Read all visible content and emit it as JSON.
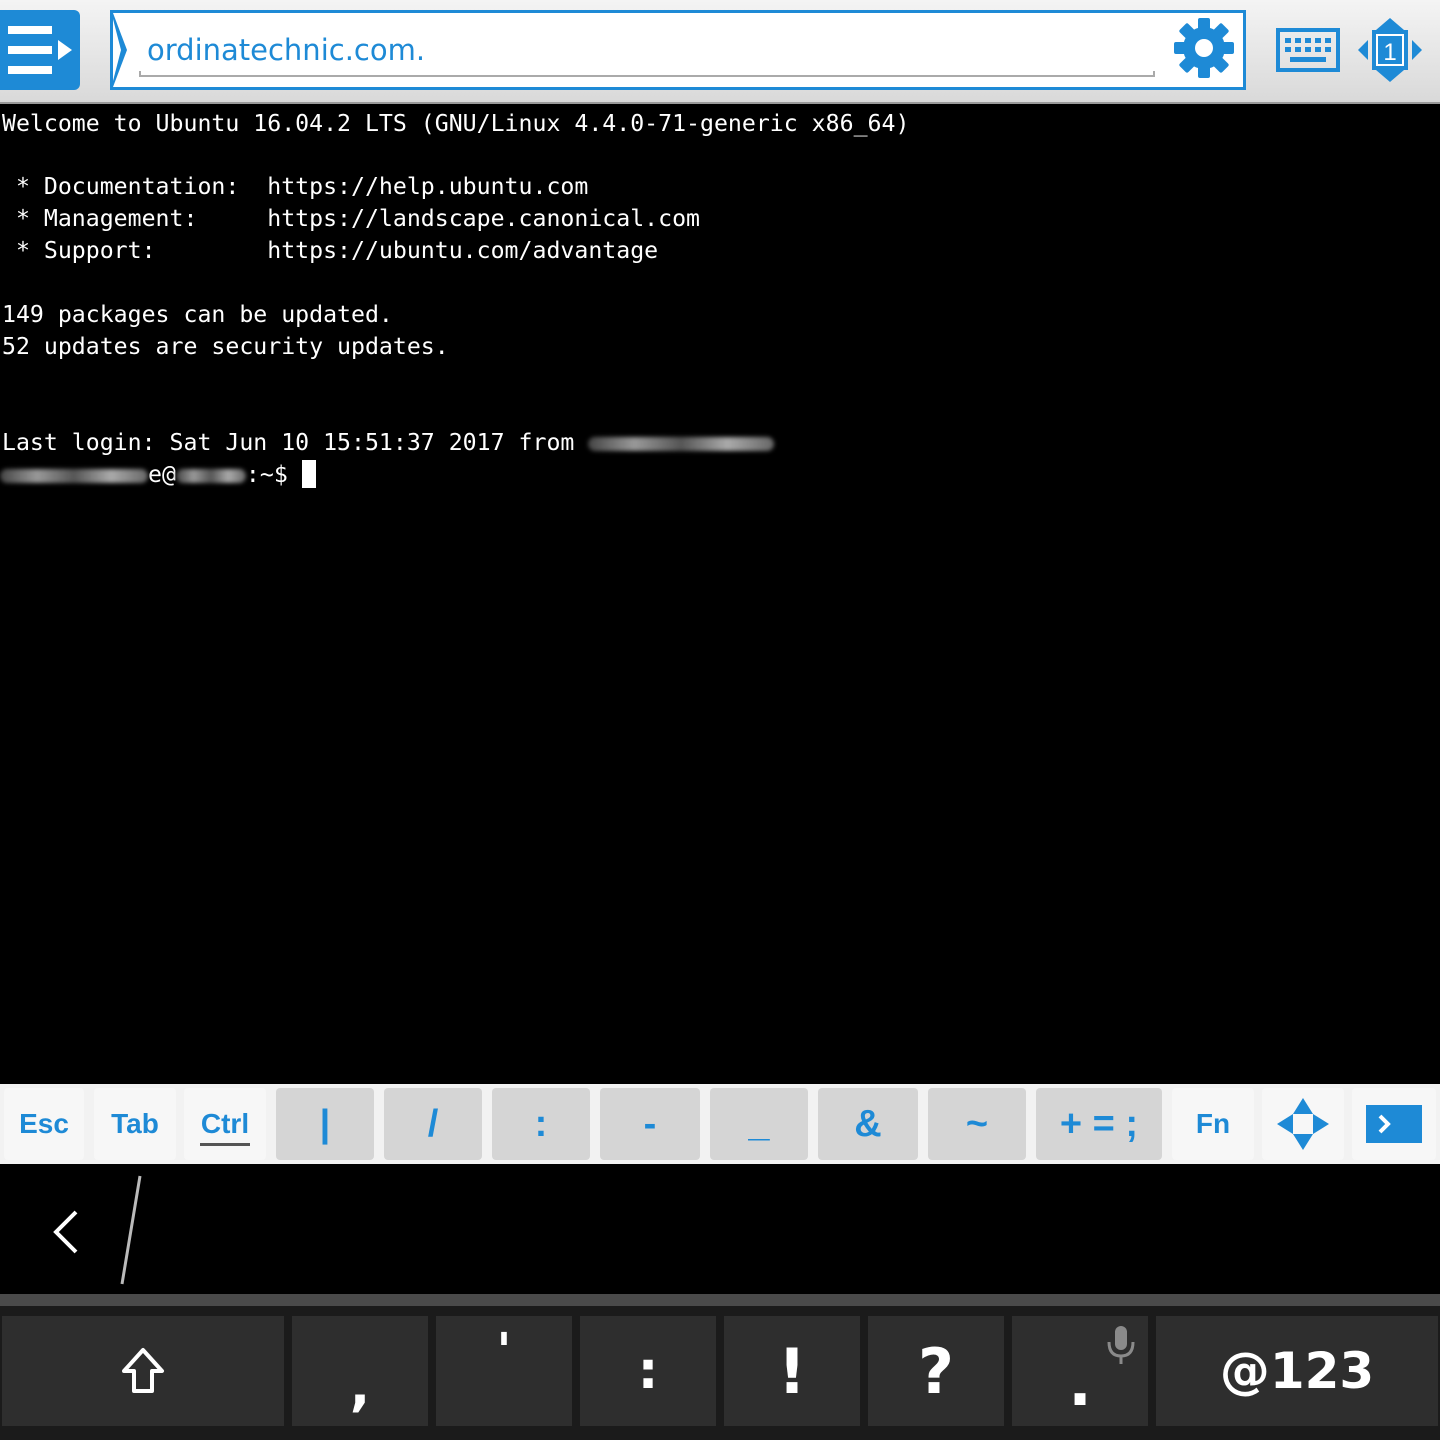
{
  "toolbar": {
    "address": "ordinatechnic.com.",
    "session_number": "1",
    "accent_color": "#1e8ad6",
    "icons": [
      "menu-icon",
      "gear-icon",
      "keyboard-icon",
      "screens-icon"
    ]
  },
  "terminal": {
    "lines": [
      "Welcome to Ubuntu 16.04.2 LTS (GNU/Linux 4.4.0-71-generic x86_64)",
      "",
      " * Documentation:  https://help.ubuntu.com",
      " * Management:     https://landscape.canonical.com",
      " * Support:        https://ubuntu.com/advantage",
      "",
      "149 packages can be updated.",
      "52 updates are security updates.",
      "",
      "",
      "Last login: Sat Jun 10 15:51:37 2017 from "
    ],
    "prompt_user_redacted_suffix": "e@",
    "prompt_suffix": ":~$ "
  },
  "extra_keys": {
    "esc": "Esc",
    "tab": "Tab",
    "ctrl": "Ctrl",
    "pipe": "|",
    "slash": "/",
    "colon": ":",
    "dash": "-",
    "underscore": "_",
    "amp": "&",
    "tilde": "~",
    "plus_eq_semi": "+ = ;",
    "fn": "Fn"
  },
  "keyboard": {
    "comma": ",",
    "apostrophe": "'",
    "colon": ":",
    "exclaim": "!",
    "question": "?",
    "period": ".",
    "symbols": "@123"
  }
}
